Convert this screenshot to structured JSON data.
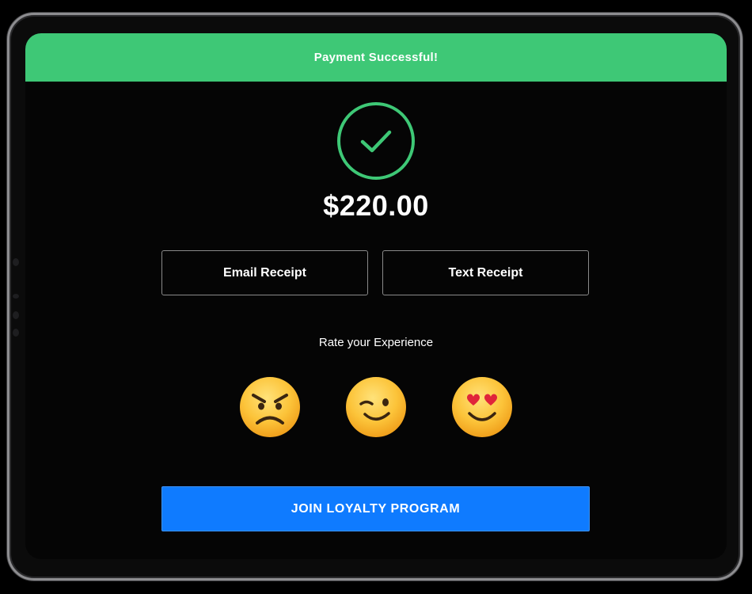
{
  "banner": {
    "text": "Payment Successful!"
  },
  "payment": {
    "amount": "$220.00",
    "status_icon": "check-circle-icon"
  },
  "receipts": {
    "email_label": "Email Receipt",
    "text_label": "Text Receipt"
  },
  "rating": {
    "label": "Rate your Experience",
    "options": [
      {
        "icon": "angry-face-icon"
      },
      {
        "icon": "winking-face-icon"
      },
      {
        "icon": "heart-eyes-face-icon"
      }
    ]
  },
  "loyalty": {
    "button_label": "JOIN LOYALTY PROGRAM"
  },
  "colors": {
    "success_green": "#3ec876",
    "primary_blue": "#0f7bff",
    "background": "#050505"
  }
}
